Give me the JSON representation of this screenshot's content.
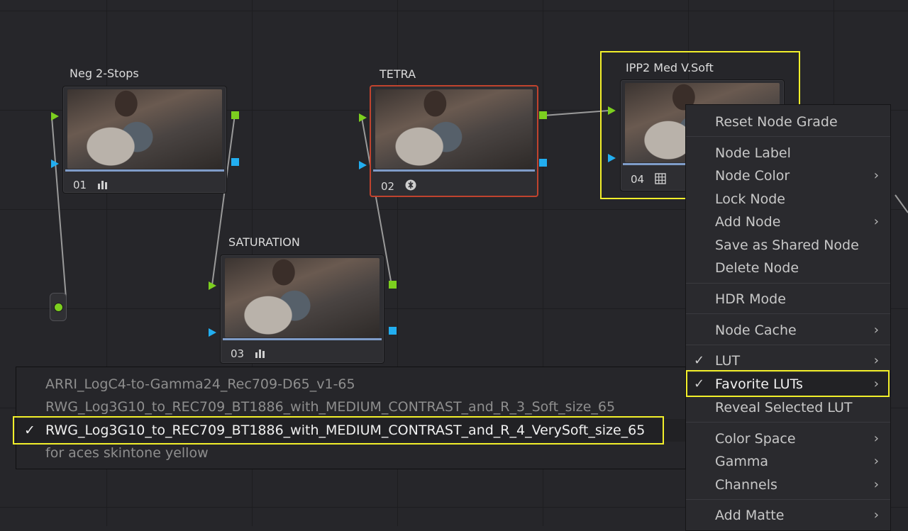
{
  "nodes": [
    {
      "title": "Neg 2-Stops",
      "number": "01",
      "icon": "bars-icon"
    },
    {
      "title": "TETRA",
      "number": "02",
      "icon": "aperture-icon"
    },
    {
      "title": "IPP2 Med V.Soft",
      "number": "04",
      "icon": "grid-icon"
    },
    {
      "title": "SATURATION",
      "number": "03",
      "icon": "bars-icon"
    }
  ],
  "context_menu": {
    "items": [
      {
        "label": "Reset Node Grade"
      },
      {
        "label": "Node Label"
      },
      {
        "label": "Node Color",
        "submenu": true
      },
      {
        "label": "Lock Node"
      },
      {
        "label": "Add Node",
        "submenu": true
      },
      {
        "label": "Save as Shared Node"
      },
      {
        "label": "Delete Node"
      },
      {
        "label": "HDR Mode"
      },
      {
        "label": "Node Cache",
        "submenu": true
      },
      {
        "label": "LUT",
        "submenu": true,
        "checked": true
      },
      {
        "label": "Favorite LUTs",
        "submenu": true,
        "checked": true,
        "active": true
      },
      {
        "label": "Reveal Selected LUT"
      },
      {
        "label": "Color Space",
        "submenu": true
      },
      {
        "label": "Gamma",
        "submenu": true
      },
      {
        "label": "Channels",
        "submenu": true
      },
      {
        "label": "Add Matte",
        "submenu": true
      }
    ],
    "chevron": "›",
    "check": "✓"
  },
  "favorite_luts": {
    "items": [
      {
        "label": "ARRI_LogC4-to-Gamma24_Rec709-D65_v1-65"
      },
      {
        "label": "RWG_Log3G10_to_REC709_BT1886_with_MEDIUM_CONTRAST_and_R_3_Soft_size_65"
      },
      {
        "label": "RWG_Log3G10_to_REC709_BT1886_with_MEDIUM_CONTRAST_and_R_4_VerySoft_size_65",
        "checked": true
      },
      {
        "label": "for aces skintone yellow"
      }
    ]
  },
  "colors": {
    "highlight": "#f2ef2a",
    "selected_node_border": "#c0432e",
    "rgb_port": "#7ccf1f",
    "alpha_port": "#22aef0"
  }
}
